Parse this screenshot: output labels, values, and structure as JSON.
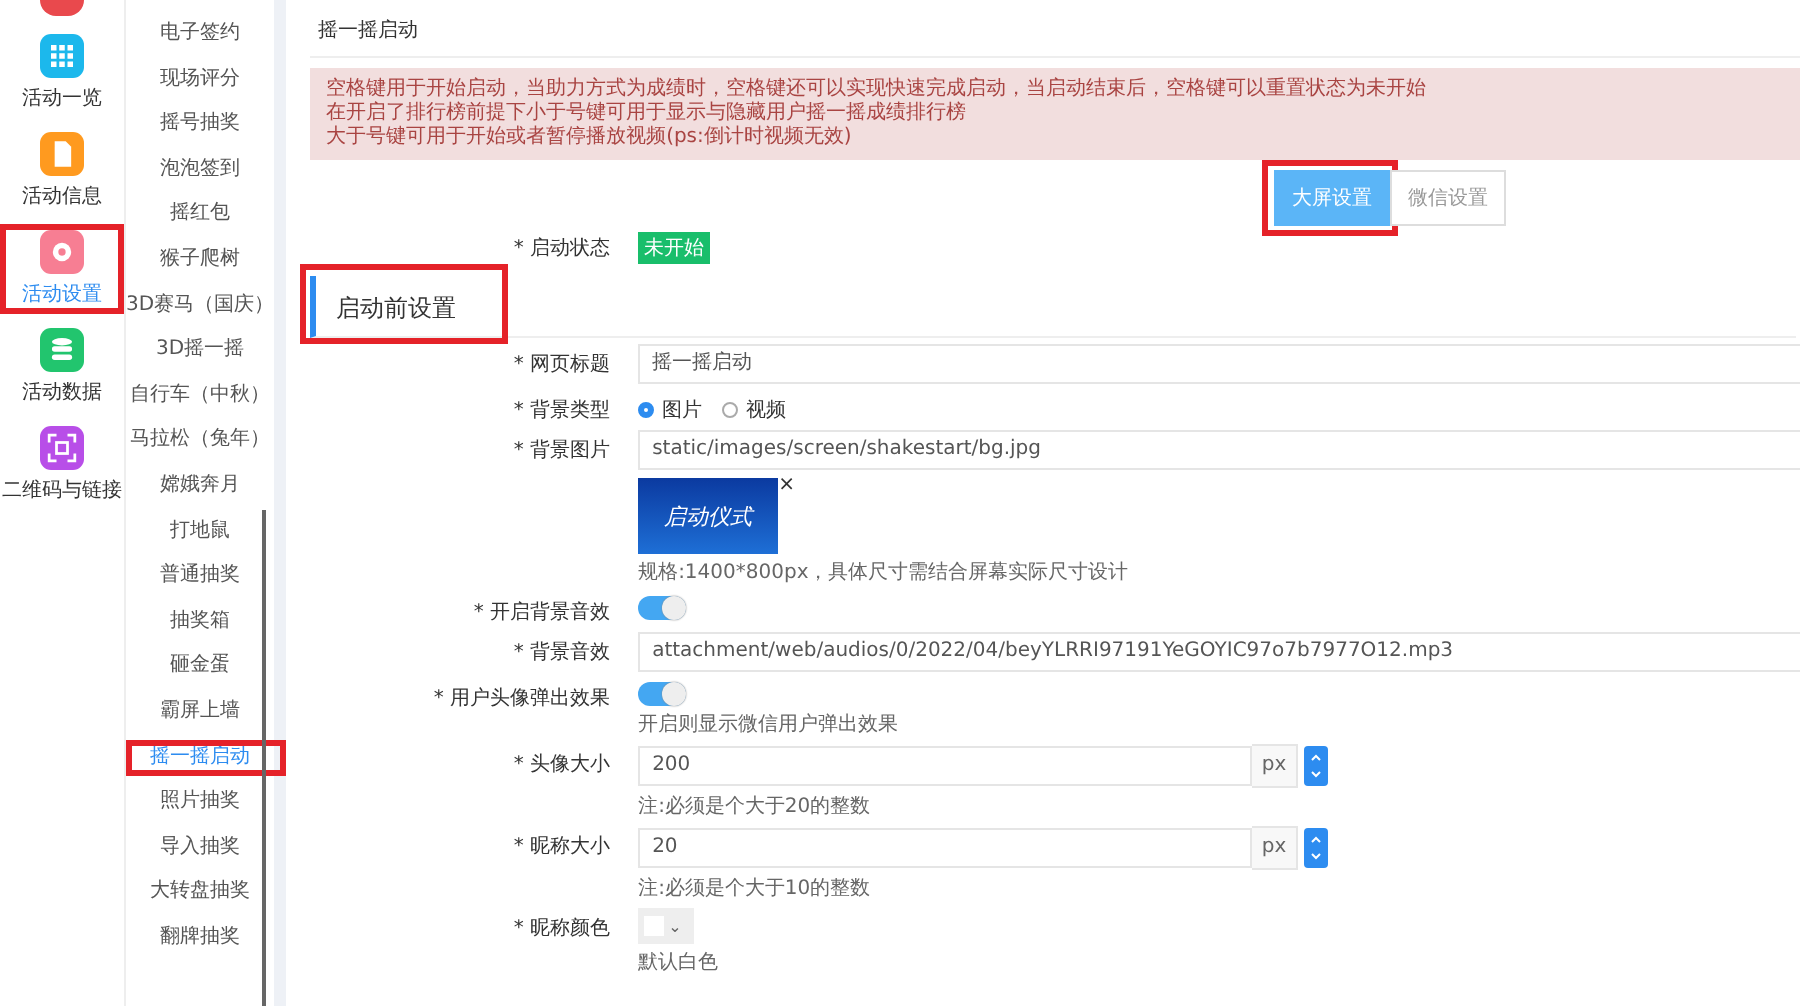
{
  "nav": [
    {
      "label": "活动一览",
      "color": "#1cb8ec",
      "kind": "grid",
      "selected": false
    },
    {
      "label": "活动信息",
      "color": "#ff9a1f",
      "kind": "doc",
      "selected": false
    },
    {
      "label": "活动设置",
      "color": "#f77e93",
      "kind": "gear",
      "selected": true
    },
    {
      "label": "活动数据",
      "color": "#22c56e",
      "kind": "db",
      "selected": false
    },
    {
      "label": "二维码与链接",
      "color": "#b84ee8",
      "kind": "qr",
      "selected": false
    }
  ],
  "menu": [
    {
      "label": "电子签约",
      "selected": false
    },
    {
      "label": "现场评分",
      "selected": false
    },
    {
      "label": "摇号抽奖",
      "selected": false
    },
    {
      "label": "泡泡签到",
      "selected": false
    },
    {
      "label": "摇红包",
      "selected": false
    },
    {
      "label": "猴子爬树",
      "selected": false
    },
    {
      "label": "3D赛马（国庆）",
      "selected": false
    },
    {
      "label": "3D摇一摇",
      "selected": false
    },
    {
      "label": "自行车（中秋）",
      "selected": false
    },
    {
      "label": "马拉松（兔年）",
      "selected": false
    },
    {
      "label": "嫦娥奔月",
      "selected": false
    },
    {
      "label": "打地鼠",
      "selected": false
    },
    {
      "label": "普通抽奖",
      "selected": false
    },
    {
      "label": "抽奖箱",
      "selected": false
    },
    {
      "label": "砸金蛋",
      "selected": false
    },
    {
      "label": "霸屏上墙",
      "selected": false
    },
    {
      "label": "摇一摇启动",
      "selected": true
    },
    {
      "label": "照片抽奖",
      "selected": false
    },
    {
      "label": "导入抽奖",
      "selected": false
    },
    {
      "label": "大转盘抽奖",
      "selected": false
    },
    {
      "label": "翻牌抽奖",
      "selected": false
    }
  ],
  "page_title": "摇一摇启动",
  "alert": [
    "空格键用于开始启动，当助力方式为成绩时，空格键还可以实现快速完成启动，当启动结束后，空格键可以重置状态为未开始",
    "在开启了排行榜前提下小于号键可用于显示与隐藏用户摇一摇成绩排行榜",
    "大于号键可用于开始或者暂停播放视频(ps:倒计时视频无效)"
  ],
  "buttons": [
    {
      "label": "大屏设置",
      "selected": true
    },
    {
      "label": "微信设置",
      "selected": false
    }
  ],
  "status": {
    "label": "* 启动状态",
    "badge": "未开始"
  },
  "section_title": "启动前设置",
  "form": [
    {
      "kind": "input",
      "label": "* 网页标题",
      "value": "摇一摇启动"
    },
    {
      "kind": "radio",
      "label": "* 背景类型",
      "options": [
        {
          "label": "图片",
          "selected": true
        },
        {
          "label": "视频",
          "selected": false
        }
      ]
    },
    {
      "kind": "image",
      "label": "* 背景图片",
      "value": "static/images/screen/shakestart/bg.jpg",
      "thumb_text": "启动仪式",
      "remove": "×",
      "hint": "规格:1400*800px，具体尺寸需结合屏幕实际尺寸设计"
    },
    {
      "kind": "toggle",
      "label": "* 开启背景音效",
      "on": true
    },
    {
      "kind": "input",
      "label": "* 背景音效",
      "value": "attachment/web/audios/0/2022/04/beyYLRRI97191YeGOYIC97o7b7977O12.mp3"
    },
    {
      "kind": "toggle",
      "label": "* 用户头像弹出效果",
      "on": true,
      "hint": "开启则显示微信用户弹出效果"
    },
    {
      "kind": "number",
      "label": "* 头像大小",
      "value": "200",
      "unit": "px",
      "hint": "注:必须是个大于20的整数"
    },
    {
      "kind": "number",
      "label": "* 昵称大小",
      "value": "20",
      "unit": "px",
      "hint": "注:必须是个大于10的整数"
    },
    {
      "kind": "color",
      "label": "* 昵称颜色",
      "caret": "⌄",
      "hint": "默认白色"
    }
  ]
}
